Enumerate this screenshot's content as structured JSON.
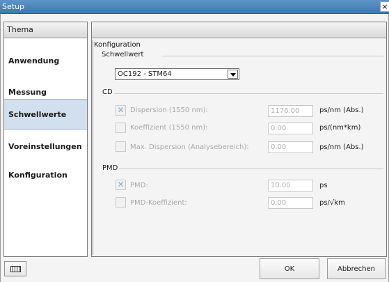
{
  "window": {
    "title": "Setup",
    "close": "×"
  },
  "sidebar": {
    "header": "Thema",
    "items": [
      {
        "label": "Anwendung"
      },
      {
        "label": "Messung"
      },
      {
        "label": "Schwellwerte",
        "active": true
      },
      {
        "label": "Voreinstellungen"
      },
      {
        "label": "Konfiguration"
      }
    ]
  },
  "config": {
    "group_title": "Konfiguration",
    "threshold_label": "Schwellwert",
    "threshold_value": "OC192 - STM64",
    "cd_label": "CD",
    "pmd_label": "PMD",
    "cd_rows": [
      {
        "label": "Dispersion (1550 nm):",
        "checked": true,
        "value": "1176.00",
        "unit": "ps/nm (Abs.)"
      },
      {
        "label": "Koeffizient (1550 nm):",
        "checked": false,
        "value": "0.00",
        "unit": "ps/(nm*km)"
      },
      {
        "label": "Max. Dispersion (Analysebereich):",
        "checked": false,
        "value": "0.00",
        "unit": "ps/nm (Abs.)"
      }
    ],
    "pmd_rows": [
      {
        "label": "PMD:",
        "checked": true,
        "value": "10.00",
        "unit": "ps"
      },
      {
        "label": "PMD-Koeffizient:",
        "checked": false,
        "value": "0.00",
        "unit": "ps/√km"
      }
    ]
  },
  "footer": {
    "ok": "OK",
    "cancel": "Abbrechen",
    "keyboard_icon": "keyboard-icon"
  },
  "colors": {
    "titlebar": "#3f78ad",
    "active_item": "#d2dfef"
  }
}
